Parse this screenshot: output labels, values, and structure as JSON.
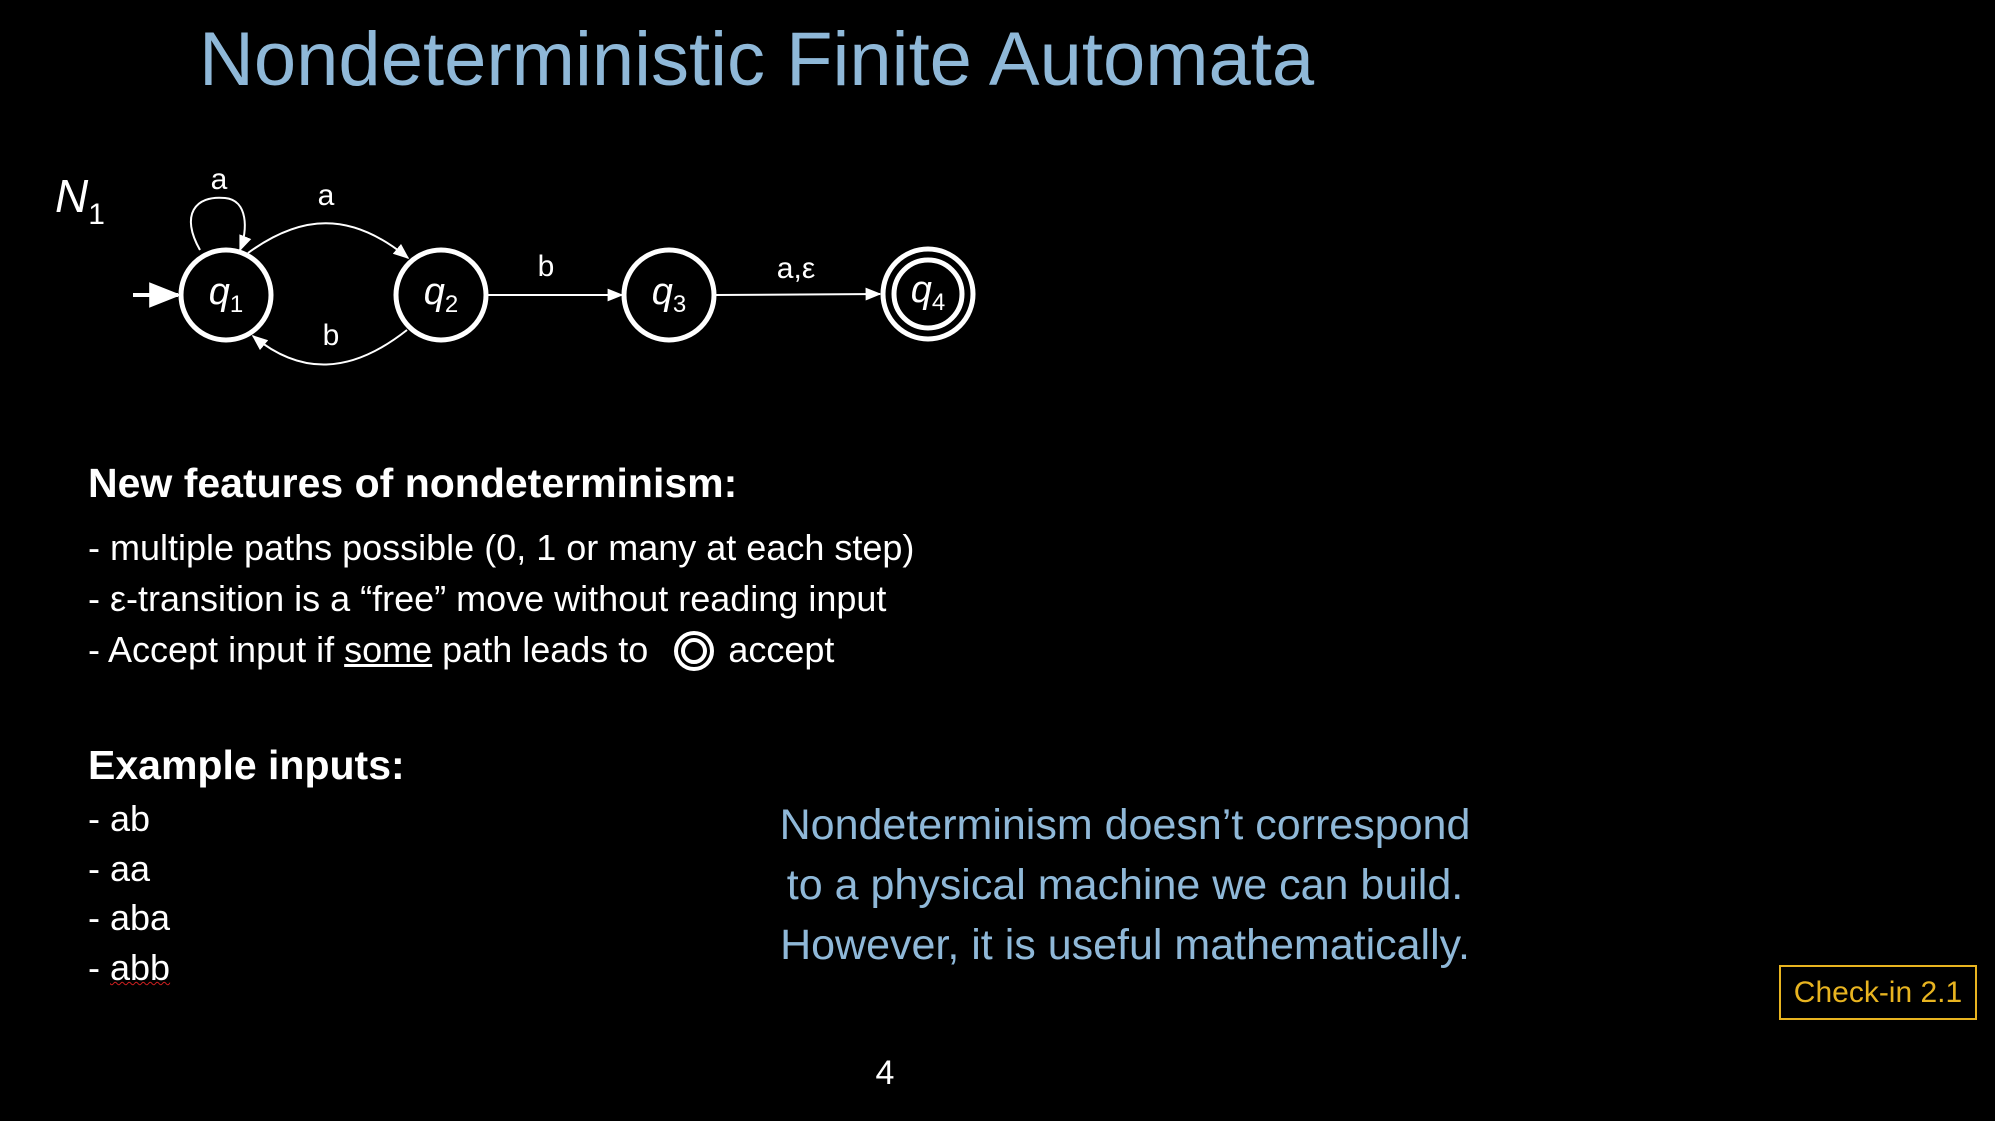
{
  "slide": {
    "title": "Nondeterministic Finite Automata",
    "page_number": "4",
    "checkin_label": "Check-in 2.1",
    "accent_color": "#8fb8d8",
    "checkin_color": "#e8b420"
  },
  "automaton": {
    "name": "N",
    "name_subscript": "1",
    "states": [
      {
        "label": "q",
        "sub": "1",
        "start": true,
        "accept": false
      },
      {
        "label": "q",
        "sub": "2",
        "start": false,
        "accept": false
      },
      {
        "label": "q",
        "sub": "3",
        "start": false,
        "accept": false
      },
      {
        "label": "q",
        "sub": "4",
        "start": false,
        "accept": true
      }
    ],
    "transitions": [
      {
        "from": "q1",
        "to": "q1",
        "label": "a"
      },
      {
        "from": "q1",
        "to": "q2",
        "label": "a"
      },
      {
        "from": "q2",
        "to": "q1",
        "label": "b"
      },
      {
        "from": "q2",
        "to": "q3",
        "label": "b"
      },
      {
        "from": "q3",
        "to": "q4",
        "label": "a,ε"
      }
    ]
  },
  "features": {
    "heading": "New features of nondeterminism:",
    "items": [
      "- multiple paths possible (0, 1 or many at each step)",
      "- ε-transition is a “free” move without reading input"
    ],
    "accept_line": {
      "prefix": "- Accept input if ",
      "underlined": "some",
      "middle": " path leads to",
      "suffix": "accept"
    }
  },
  "examples": {
    "heading": "Example inputs:",
    "items": [
      "- ab",
      "- aa",
      "- aba",
      "- "
    ],
    "last_word": "abb"
  },
  "remark": {
    "lines": [
      "Nondeterminism doesn’t correspond",
      "to a physical machine we can build.",
      "However, it is useful mathematically."
    ]
  }
}
